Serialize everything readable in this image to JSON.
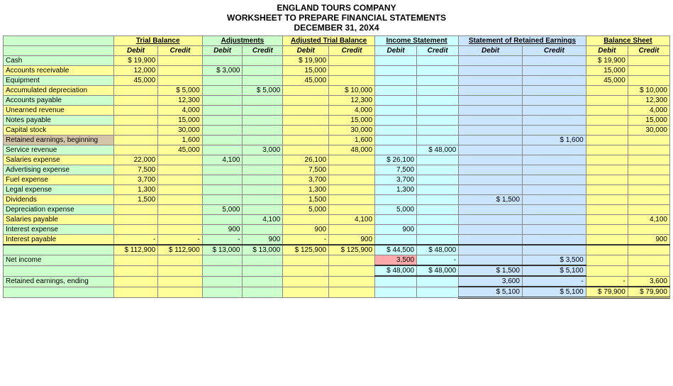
{
  "title": {
    "line1": "ENGLAND TOURS COMPANY",
    "line2": "WORKSHEET TO PREPARE FINANCIAL STATEMENTS",
    "line3": "DECEMBER 31, 20X4"
  },
  "sections": {
    "trial_balance": "Trial Balance",
    "adjustments": "Adjustments",
    "adjusted_trial_balance": "Adjusted Trial Balance",
    "income_statement": "Income Statement",
    "retained_earnings": "Statement of Retained Earnings",
    "balance_sheet": "Balance Sheet"
  },
  "col_headers": {
    "debit": "Debit",
    "credit": "Credit"
  },
  "rows": [
    {
      "label": "Cash",
      "tb_d": "$ 19,900",
      "tb_c": "",
      "adj_d": "",
      "adj_c": "",
      "atb_d": "$ 19,900",
      "atb_c": "",
      "is_d": "",
      "is_c": "",
      "re_d": "",
      "re_c": "",
      "bs_d": "$ 19,900",
      "bs_c": "",
      "bg": "green"
    },
    {
      "label": "Accounts receivable",
      "tb_d": "12,000",
      "tb_c": "",
      "adj_d": "$ 3,000",
      "adj_c": "",
      "atb_d": "15,000",
      "atb_c": "",
      "is_d": "",
      "is_c": "",
      "re_d": "",
      "re_c": "",
      "bs_d": "15,000",
      "bs_c": "",
      "bg": "yellow"
    },
    {
      "label": "Equipment",
      "tb_d": "45,000",
      "tb_c": "",
      "adj_d": "",
      "adj_c": "",
      "atb_d": "45,000",
      "atb_c": "",
      "is_d": "",
      "is_c": "",
      "re_d": "",
      "re_c": "",
      "bs_d": "45,000",
      "bs_c": "",
      "bg": "green"
    },
    {
      "label": "Accumulated depreciation",
      "tb_d": "",
      "tb_c": "$ 5,000",
      "adj_d": "",
      "adj_c": "$ 5,000",
      "atb_d": "",
      "atb_c": "$ 10,000",
      "is_d": "",
      "is_c": "",
      "re_d": "",
      "re_c": "",
      "bs_d": "",
      "bs_c": "$ 10,000",
      "bg": "yellow"
    },
    {
      "label": "Accounts payable",
      "tb_d": "",
      "tb_c": "12,300",
      "adj_d": "",
      "adj_c": "",
      "atb_d": "",
      "atb_c": "12,300",
      "is_d": "",
      "is_c": "",
      "re_d": "",
      "re_c": "",
      "bs_d": "",
      "bs_c": "12,300",
      "bg": "green"
    },
    {
      "label": "Unearned revenue",
      "tb_d": "",
      "tb_c": "4,000",
      "adj_d": "",
      "adj_c": "",
      "atb_d": "",
      "atb_c": "4,000",
      "is_d": "",
      "is_c": "",
      "re_d": "",
      "re_c": "",
      "bs_d": "",
      "bs_c": "4,000",
      "bg": "yellow"
    },
    {
      "label": "Notes payable",
      "tb_d": "",
      "tb_c": "15,000",
      "adj_d": "",
      "adj_c": "",
      "atb_d": "",
      "atb_c": "15,000",
      "is_d": "",
      "is_c": "",
      "re_d": "",
      "re_c": "",
      "bs_d": "",
      "bs_c": "15,000",
      "bg": "green"
    },
    {
      "label": "Capital stock",
      "tb_d": "",
      "tb_c": "30,000",
      "adj_d": "",
      "adj_c": "",
      "atb_d": "",
      "atb_c": "30,000",
      "is_d": "",
      "is_c": "",
      "re_d": "",
      "re_c": "",
      "bs_d": "",
      "bs_c": "30,000",
      "bg": "yellow"
    },
    {
      "label": "Retained earnings, beginning",
      "tb_d": "",
      "tb_c": "1,600",
      "adj_d": "",
      "adj_c": "",
      "atb_d": "",
      "atb_c": "1,600",
      "is_d": "",
      "is_c": "",
      "re_d": "",
      "re_c": "$ 1,600",
      "bs_d": "",
      "bs_c": "",
      "bg": "retained"
    },
    {
      "label": "Service revenue",
      "tb_d": "",
      "tb_c": "45,000",
      "adj_d": "",
      "adj_c": "3,000",
      "atb_d": "",
      "atb_c": "48,000",
      "is_d": "",
      "is_c": "$ 48,000",
      "re_d": "",
      "re_c": "",
      "bs_d": "",
      "bs_c": "",
      "bg": "green"
    },
    {
      "label": "Salaries expense",
      "tb_d": "22,000",
      "tb_c": "",
      "adj_d": "4,100",
      "adj_c": "",
      "atb_d": "26,100",
      "atb_c": "",
      "is_d": "$ 26,100",
      "is_c": "",
      "re_d": "",
      "re_c": "",
      "bs_d": "",
      "bs_c": "",
      "bg": "yellow"
    },
    {
      "label": "Advertising expense",
      "tb_d": "7,500",
      "tb_c": "",
      "adj_d": "",
      "adj_c": "",
      "atb_d": "7,500",
      "atb_c": "",
      "is_d": "7,500",
      "is_c": "",
      "re_d": "",
      "re_c": "",
      "bs_d": "",
      "bs_c": "",
      "bg": "green"
    },
    {
      "label": "Fuel expense",
      "tb_d": "3,700",
      "tb_c": "",
      "adj_d": "",
      "adj_c": "",
      "atb_d": "3,700",
      "atb_c": "",
      "is_d": "3,700",
      "is_c": "",
      "re_d": "",
      "re_c": "",
      "bs_d": "",
      "bs_c": "",
      "bg": "yellow"
    },
    {
      "label": "Legal expense",
      "tb_d": "1,300",
      "tb_c": "",
      "adj_d": "",
      "adj_c": "",
      "atb_d": "1,300",
      "atb_c": "",
      "is_d": "1,300",
      "is_c": "",
      "re_d": "",
      "re_c": "",
      "bs_d": "",
      "bs_c": "",
      "bg": "green"
    },
    {
      "label": "Dividends",
      "tb_d": "1,500",
      "tb_c": "",
      "adj_d": "",
      "adj_c": "",
      "atb_d": "1,500",
      "atb_c": "",
      "is_d": "",
      "is_c": "",
      "re_d": "$ 1,500",
      "re_c": "",
      "bs_d": "",
      "bs_c": "",
      "bg": "yellow"
    },
    {
      "label": "Depreciation expense",
      "tb_d": "",
      "tb_c": "",
      "adj_d": "5,000",
      "adj_c": "",
      "atb_d": "5,000",
      "atb_c": "",
      "is_d": "5,000",
      "is_c": "",
      "re_d": "",
      "re_c": "",
      "bs_d": "",
      "bs_c": "",
      "bg": "green"
    },
    {
      "label": "Salaries payable",
      "tb_d": "",
      "tb_c": "",
      "adj_d": "",
      "adj_c": "4,100",
      "atb_d": "",
      "atb_c": "4,100",
      "is_d": "",
      "is_c": "",
      "re_d": "",
      "re_c": "",
      "bs_d": "",
      "bs_c": "4,100",
      "bg": "yellow"
    },
    {
      "label": "Interest expense",
      "tb_d": "",
      "tb_c": "",
      "adj_d": "900",
      "adj_c": "",
      "atb_d": "900",
      "atb_c": "",
      "is_d": "900",
      "is_c": "",
      "re_d": "",
      "re_c": "",
      "bs_d": "",
      "bs_c": "",
      "bg": "green"
    },
    {
      "label": "Interest payable",
      "tb_d": "-",
      "tb_c": "-",
      "adj_d": "-",
      "adj_c": "900",
      "atb_d": "-",
      "atb_c": "900",
      "is_d": "",
      "is_c": "",
      "re_d": "",
      "re_c": "",
      "bs_d": "",
      "bs_c": "900",
      "bg": "yellow"
    }
  ],
  "totals_row": {
    "label": "",
    "tb_d": "$ 112,900",
    "tb_c": "$ 112,900",
    "adj_d": "$ 13,000",
    "adj_c": "$ 13,000",
    "atb_d": "$ 125,900",
    "atb_c": "$ 125,900",
    "is_d": "$ 44,500",
    "is_c": "$ 48,000",
    "re_d": "",
    "re_c": "",
    "bs_d": "",
    "bs_c": ""
  },
  "net_income_row": {
    "label": "Net income",
    "is_d_highlight": "3,500",
    "re_c": "$ 3,500"
  },
  "subtotal_row": {
    "is_d": "$ 48,000",
    "is_c": "$ 48,000",
    "re_d": "$ 1,500",
    "re_c": "$ 5,100"
  },
  "retained_end_row": {
    "label": "Retained earnings, ending",
    "re_d1": "3,600",
    "re_d2": "-",
    "bs_c": "3,600"
  },
  "final_totals": {
    "re_d": "$ 5,100",
    "re_c": "$ 5,100",
    "bs_d": "$ 79,900",
    "bs_c": "$ 79,900"
  }
}
